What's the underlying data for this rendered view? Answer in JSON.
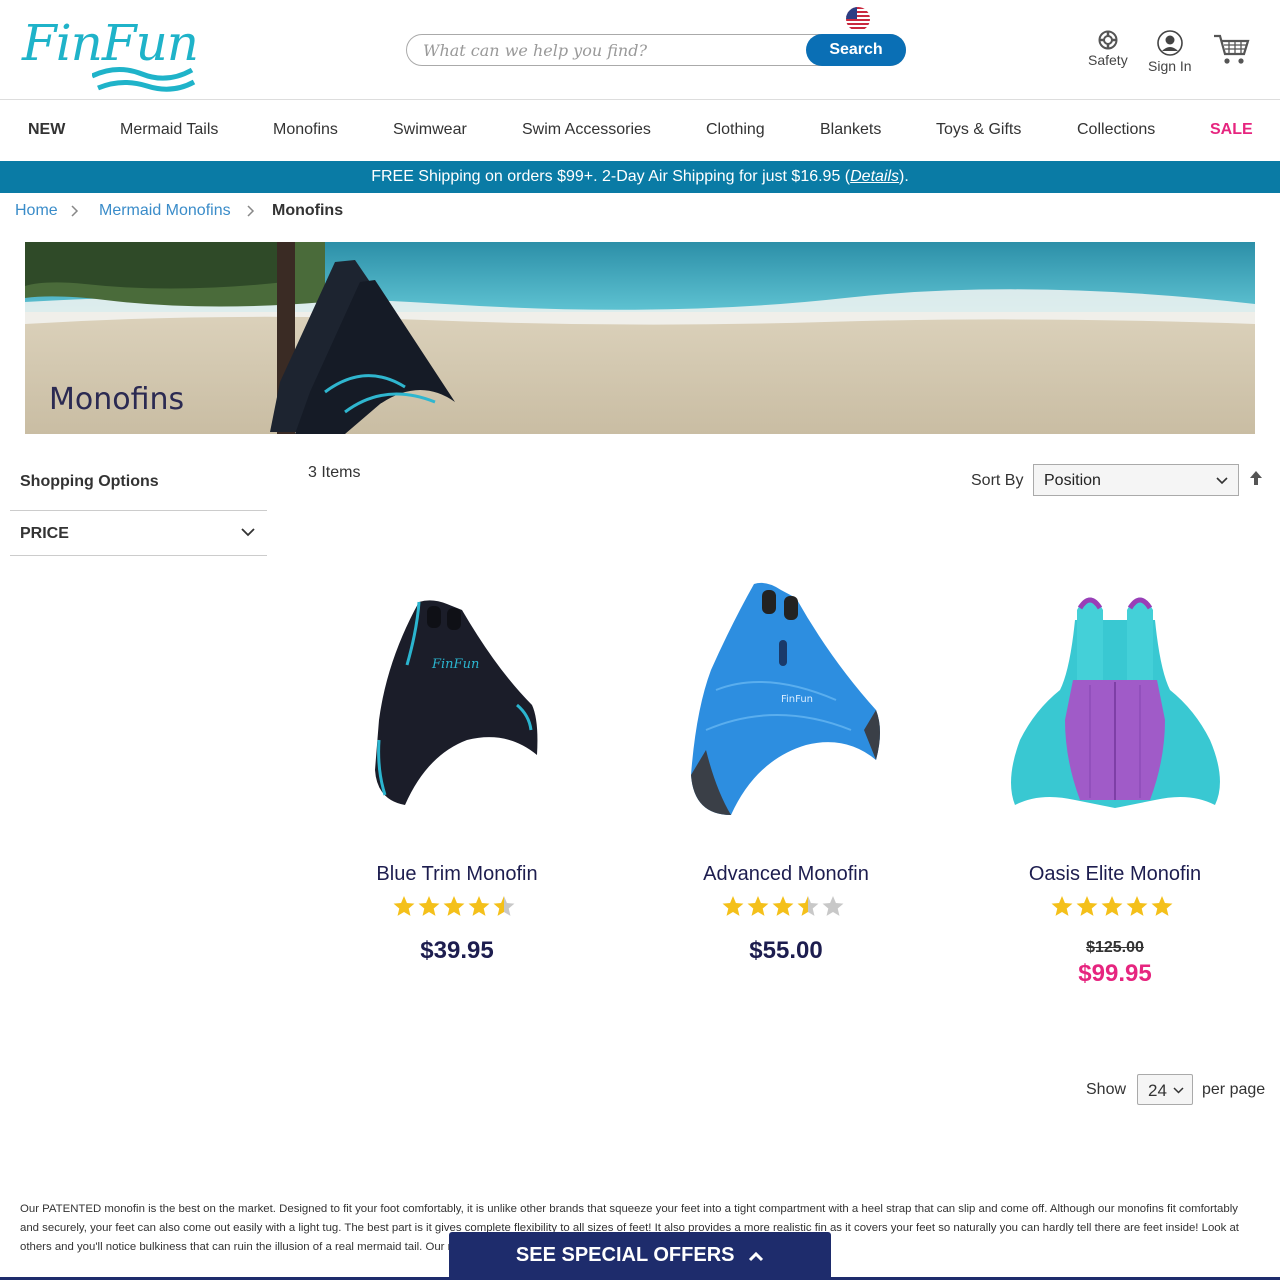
{
  "header": {
    "logo_text": "FinFun",
    "search_placeholder": "What can we help you find?",
    "search_button": "Search",
    "safety_label": "Safety",
    "signin_label": "Sign In"
  },
  "nav": {
    "items": [
      "NEW",
      "Mermaid Tails",
      "Monofins",
      "Swimwear",
      "Swim Accessories",
      "Clothing",
      "Blankets",
      "Toys & Gifts",
      "Collections",
      "SALE"
    ]
  },
  "shipping": {
    "text": "FREE Shipping on orders $99+. 2-Day Air Shipping for just $16.95 (",
    "details": "Details",
    "close": ")."
  },
  "breadcrumb": {
    "home": "Home",
    "parent": "Mermaid Monofins",
    "current": "Monofins"
  },
  "banner": {
    "title": "Monofins"
  },
  "sidebar": {
    "heading": "Shopping Options",
    "filter": "PRICE"
  },
  "toolbar": {
    "count": "3 Items",
    "sort_label": "Sort By",
    "sort_value": "Position",
    "show_label": "Show",
    "show_value": "24",
    "per_page": "per page"
  },
  "products": [
    {
      "name": "Blue Trim Monofin",
      "rating": 4.5,
      "price": "$39.95"
    },
    {
      "name": "Advanced Monofin",
      "rating": 3.5,
      "price": "$55.00"
    },
    {
      "name": "Oasis Elite Monofin",
      "rating": 5,
      "old_price": "$125.00",
      "price": "$99.95"
    }
  ],
  "description": "Our PATENTED monofin is the best on the market. Designed to fit your foot comfortably, it is unlike other brands that squeeze your feet into a tight compartment with a heel strap that can slip and come off. Although our monofins fit comfortably and securely, your feet can also come out easily with a light tug. The best part is it gives complete flexibility to all sizes of feet! It also provides a more realistic fin as it covers your feet so naturally you can hardly tell there are feet inside! Look at others and you'll notice bulkiness that can ruin the illusion of a real mermaid tail. Our monofins are so thin and lightweight they are practically undetectable!",
  "offers_label": "SEE SPECIAL OFFERS",
  "colors": {
    "brand_teal": "#1fb3c9",
    "primary_blue": "#0a6fb5",
    "ship_bar": "#0a7ba5",
    "navy": "#1e2c6c",
    "sale_pink": "#e6257f",
    "star": "#f4c01a"
  }
}
